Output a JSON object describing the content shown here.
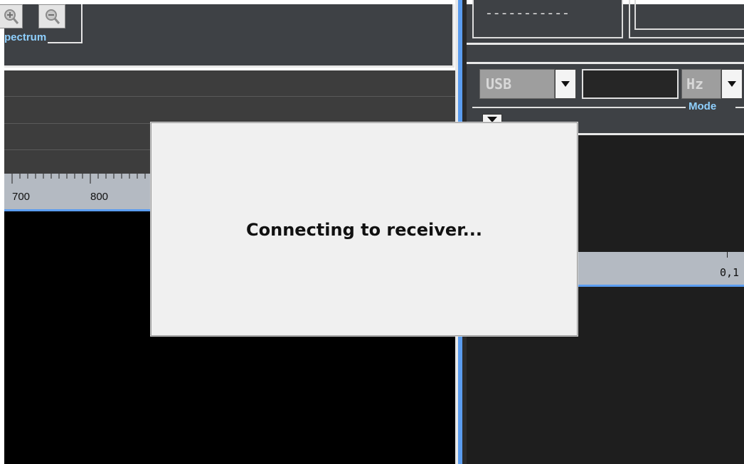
{
  "spectrum_panel": {
    "group_label": "pectrum",
    "zoom_in_icon": "zoom-in-icon",
    "zoom_out_icon": "zoom-out-icon",
    "ruler_labels": [
      "700",
      "800"
    ]
  },
  "receiver_panel": {
    "frequency_display": "-----------",
    "mode_group_label": "Mode",
    "mode_value": "USB",
    "offset_value": "",
    "unit_value": "Hz",
    "scope_ruler_label": "0,1"
  },
  "dialog": {
    "message": "Connecting to receiver..."
  },
  "colors": {
    "panel_bg": "#3e4145",
    "label_accent": "#8fd0ff",
    "splitter_accent": "#5b9df0",
    "dialog_bg": "#f0f0f0"
  }
}
